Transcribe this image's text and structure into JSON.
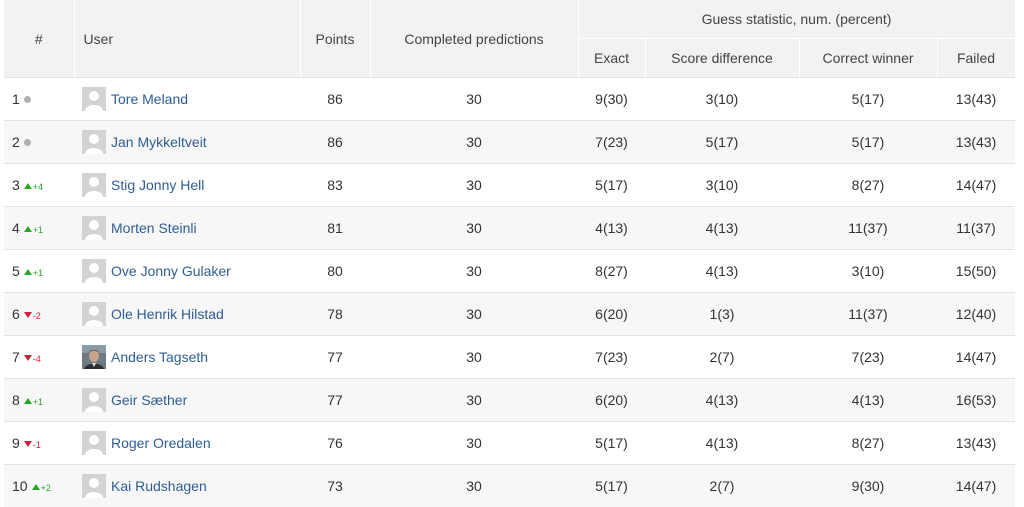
{
  "headers": {
    "rank": "#",
    "user": "User",
    "points": "Points",
    "completed": "Completed predictions",
    "guess_group": "Guess statistic, num. (percent)",
    "exact": "Exact",
    "score_difference": "Score difference",
    "correct_winner": "Correct winner",
    "failed": "Failed"
  },
  "colors": {
    "link": "#2e5d93",
    "up": "#2aa52a",
    "down": "#d02040",
    "neutral": "#b0b0b0",
    "header_bg": "#f2f2f2"
  },
  "rows": [
    {
      "rank": "1",
      "trend": "none",
      "delta": "",
      "avatar": "placeholder",
      "user": "Tore Meland",
      "points": "86",
      "completed": "30",
      "exact": "9(30)",
      "score_difference": "3(10)",
      "correct_winner": "5(17)",
      "failed": "13(43)"
    },
    {
      "rank": "2",
      "trend": "none",
      "delta": "",
      "avatar": "placeholder",
      "user": "Jan Mykkeltveit",
      "points": "86",
      "completed": "30",
      "exact": "7(23)",
      "score_difference": "5(17)",
      "correct_winner": "5(17)",
      "failed": "13(43)"
    },
    {
      "rank": "3",
      "trend": "up",
      "delta": "+4",
      "avatar": "placeholder",
      "user": "Stig Jonny Hell",
      "points": "83",
      "completed": "30",
      "exact": "5(17)",
      "score_difference": "3(10)",
      "correct_winner": "8(27)",
      "failed": "14(47)"
    },
    {
      "rank": "4",
      "trend": "up",
      "delta": "+1",
      "avatar": "placeholder",
      "user": "Morten Steinli",
      "points": "81",
      "completed": "30",
      "exact": "4(13)",
      "score_difference": "4(13)",
      "correct_winner": "11(37)",
      "failed": "11(37)"
    },
    {
      "rank": "5",
      "trend": "up",
      "delta": "+1",
      "avatar": "placeholder",
      "user": "Ove Jonny Gulaker",
      "points": "80",
      "completed": "30",
      "exact": "8(27)",
      "score_difference": "4(13)",
      "correct_winner": "3(10)",
      "failed": "15(50)"
    },
    {
      "rank": "6",
      "trend": "down",
      "delta": "-2",
      "avatar": "placeholder",
      "user": "Ole Henrik Hilstad",
      "points": "78",
      "completed": "30",
      "exact": "6(20)",
      "score_difference": "1(3)",
      "correct_winner": "11(37)",
      "failed": "12(40)"
    },
    {
      "rank": "7",
      "trend": "down",
      "delta": "-4",
      "avatar": "photo",
      "user": "Anders Tagseth",
      "points": "77",
      "completed": "30",
      "exact": "7(23)",
      "score_difference": "2(7)",
      "correct_winner": "7(23)",
      "failed": "14(47)"
    },
    {
      "rank": "8",
      "trend": "up",
      "delta": "+1",
      "avatar": "placeholder",
      "user": "Geir Sæther",
      "points": "77",
      "completed": "30",
      "exact": "6(20)",
      "score_difference": "4(13)",
      "correct_winner": "4(13)",
      "failed": "16(53)"
    },
    {
      "rank": "9",
      "trend": "down",
      "delta": "-1",
      "avatar": "placeholder",
      "user": "Roger Oredalen",
      "points": "76",
      "completed": "30",
      "exact": "5(17)",
      "score_difference": "4(13)",
      "correct_winner": "8(27)",
      "failed": "13(43)"
    },
    {
      "rank": "10",
      "trend": "up",
      "delta": "+2",
      "avatar": "placeholder",
      "user": "Kai Rudshagen",
      "points": "73",
      "completed": "30",
      "exact": "5(17)",
      "score_difference": "2(7)",
      "correct_winner": "9(30)",
      "failed": "14(47)"
    }
  ]
}
